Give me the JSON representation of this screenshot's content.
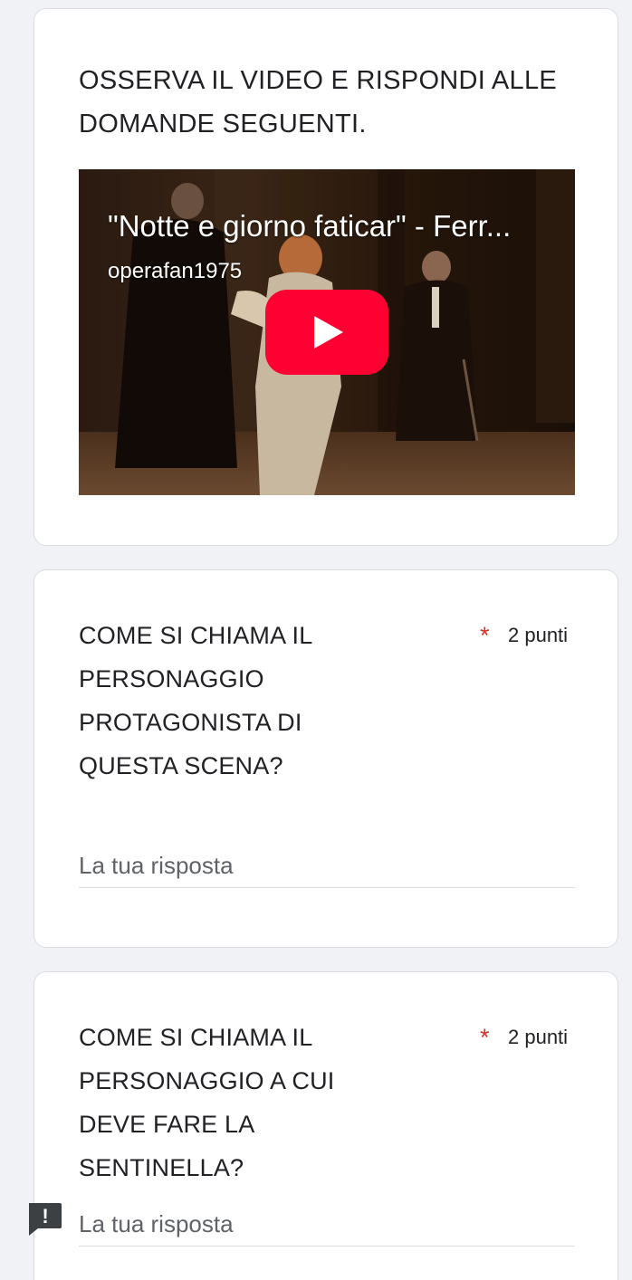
{
  "intro": {
    "title": "OSSERVA IL VIDEO E RISPONDI ALLE DOMANDE SEGUENTI.",
    "video": {
      "title": "\"Notte e giorno faticar\" - Ferr...",
      "channel": "operafan1975"
    }
  },
  "questions": [
    {
      "text": "COME SI CHIAMA IL PERSONAGGIO PROTAGONISTA DI QUESTA SCENA?",
      "required_mark": "*",
      "points": "2 punti",
      "answer_placeholder": "La tua risposta",
      "answer_value": ""
    },
    {
      "text": "COME SI CHIAMA IL PERSONAGGIO A CUI DEVE FARE LA SENTINELLA?",
      "required_mark": "*",
      "points": "2 punti",
      "answer_placeholder": "La tua risposta",
      "answer_value": "",
      "error_mark": "!"
    }
  ],
  "icons": {
    "play": "play-icon",
    "error": "error-badge-icon"
  },
  "colors": {
    "required": "#d93025",
    "play_button": "#ff0033",
    "error_badge": "#3c4043",
    "background": "#f0f2f6"
  }
}
